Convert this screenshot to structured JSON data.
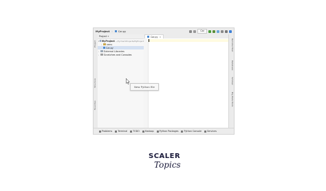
{
  "ide": {
    "breadcrumb": [
      "MyProject",
      "Car.py"
    ],
    "run_config": "Car",
    "left_tabs": [
      "Project",
      "Structure",
      "Favorites"
    ],
    "right_tabs": [
      "Remote Host",
      "Database",
      "SciView",
      "Big Data Tools"
    ],
    "project_header": "Project",
    "tree": [
      {
        "label": "MyProject",
        "extra": "~/PycharmProjects/MyProject",
        "level": 0,
        "type": "folder",
        "expanded": true
      },
      {
        "label": "venv",
        "level": 1,
        "type": "folder",
        "expanded": false
      },
      {
        "label": "Car.py",
        "level": 1,
        "type": "file",
        "selected": true
      },
      {
        "label": "External Libraries",
        "level": 0,
        "type": "folder",
        "expanded": false
      },
      {
        "label": "Scratches and Consoles",
        "level": 0,
        "type": "folder",
        "expanded": false
      }
    ],
    "editor_tab": "Car.py",
    "popup_text": "New Python file",
    "bottom_tabs": [
      "Problems",
      "Terminal",
      "TODO",
      "Hadoop",
      "Python Packages",
      "Python Console",
      "Services"
    ]
  },
  "logo": {
    "top": "SCALER",
    "bottom": "Topics"
  },
  "colors": {
    "accent_run": "#4a9c3a",
    "selection": "#d5e1f2",
    "file_icon": "#4c8bd1"
  }
}
